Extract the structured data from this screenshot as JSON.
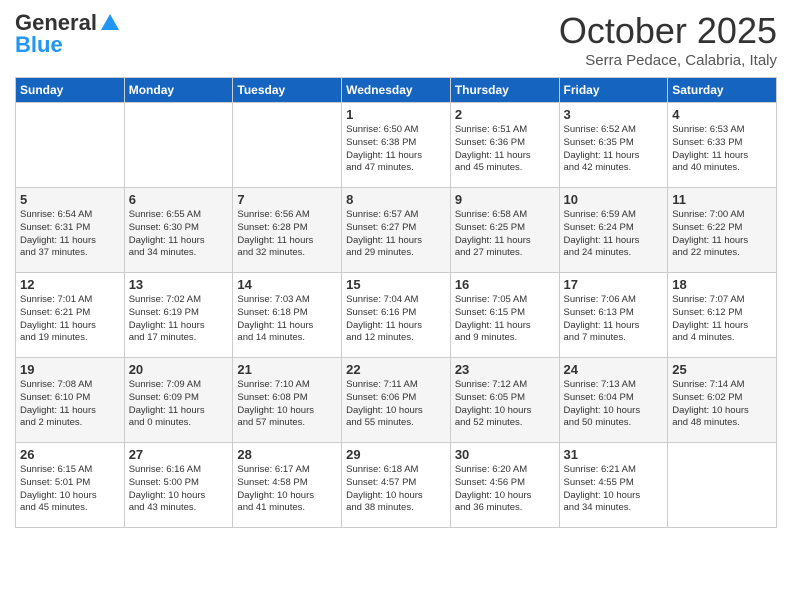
{
  "header": {
    "logo_general": "General",
    "logo_blue": "Blue",
    "month_title": "October 2025",
    "subtitle": "Serra Pedace, Calabria, Italy"
  },
  "days_of_week": [
    "Sunday",
    "Monday",
    "Tuesday",
    "Wednesday",
    "Thursday",
    "Friday",
    "Saturday"
  ],
  "weeks": [
    [
      {
        "day": "",
        "detail": ""
      },
      {
        "day": "",
        "detail": ""
      },
      {
        "day": "",
        "detail": ""
      },
      {
        "day": "1",
        "detail": "Sunrise: 6:50 AM\nSunset: 6:38 PM\nDaylight: 11 hours\nand 47 minutes."
      },
      {
        "day": "2",
        "detail": "Sunrise: 6:51 AM\nSunset: 6:36 PM\nDaylight: 11 hours\nand 45 minutes."
      },
      {
        "day": "3",
        "detail": "Sunrise: 6:52 AM\nSunset: 6:35 PM\nDaylight: 11 hours\nand 42 minutes."
      },
      {
        "day": "4",
        "detail": "Sunrise: 6:53 AM\nSunset: 6:33 PM\nDaylight: 11 hours\nand 40 minutes."
      }
    ],
    [
      {
        "day": "5",
        "detail": "Sunrise: 6:54 AM\nSunset: 6:31 PM\nDaylight: 11 hours\nand 37 minutes."
      },
      {
        "day": "6",
        "detail": "Sunrise: 6:55 AM\nSunset: 6:30 PM\nDaylight: 11 hours\nand 34 minutes."
      },
      {
        "day": "7",
        "detail": "Sunrise: 6:56 AM\nSunset: 6:28 PM\nDaylight: 11 hours\nand 32 minutes."
      },
      {
        "day": "8",
        "detail": "Sunrise: 6:57 AM\nSunset: 6:27 PM\nDaylight: 11 hours\nand 29 minutes."
      },
      {
        "day": "9",
        "detail": "Sunrise: 6:58 AM\nSunset: 6:25 PM\nDaylight: 11 hours\nand 27 minutes."
      },
      {
        "day": "10",
        "detail": "Sunrise: 6:59 AM\nSunset: 6:24 PM\nDaylight: 11 hours\nand 24 minutes."
      },
      {
        "day": "11",
        "detail": "Sunrise: 7:00 AM\nSunset: 6:22 PM\nDaylight: 11 hours\nand 22 minutes."
      }
    ],
    [
      {
        "day": "12",
        "detail": "Sunrise: 7:01 AM\nSunset: 6:21 PM\nDaylight: 11 hours\nand 19 minutes."
      },
      {
        "day": "13",
        "detail": "Sunrise: 7:02 AM\nSunset: 6:19 PM\nDaylight: 11 hours\nand 17 minutes."
      },
      {
        "day": "14",
        "detail": "Sunrise: 7:03 AM\nSunset: 6:18 PM\nDaylight: 11 hours\nand 14 minutes."
      },
      {
        "day": "15",
        "detail": "Sunrise: 7:04 AM\nSunset: 6:16 PM\nDaylight: 11 hours\nand 12 minutes."
      },
      {
        "day": "16",
        "detail": "Sunrise: 7:05 AM\nSunset: 6:15 PM\nDaylight: 11 hours\nand 9 minutes."
      },
      {
        "day": "17",
        "detail": "Sunrise: 7:06 AM\nSunset: 6:13 PM\nDaylight: 11 hours\nand 7 minutes."
      },
      {
        "day": "18",
        "detail": "Sunrise: 7:07 AM\nSunset: 6:12 PM\nDaylight: 11 hours\nand 4 minutes."
      }
    ],
    [
      {
        "day": "19",
        "detail": "Sunrise: 7:08 AM\nSunset: 6:10 PM\nDaylight: 11 hours\nand 2 minutes."
      },
      {
        "day": "20",
        "detail": "Sunrise: 7:09 AM\nSunset: 6:09 PM\nDaylight: 11 hours\nand 0 minutes."
      },
      {
        "day": "21",
        "detail": "Sunrise: 7:10 AM\nSunset: 6:08 PM\nDaylight: 10 hours\nand 57 minutes."
      },
      {
        "day": "22",
        "detail": "Sunrise: 7:11 AM\nSunset: 6:06 PM\nDaylight: 10 hours\nand 55 minutes."
      },
      {
        "day": "23",
        "detail": "Sunrise: 7:12 AM\nSunset: 6:05 PM\nDaylight: 10 hours\nand 52 minutes."
      },
      {
        "day": "24",
        "detail": "Sunrise: 7:13 AM\nSunset: 6:04 PM\nDaylight: 10 hours\nand 50 minutes."
      },
      {
        "day": "25",
        "detail": "Sunrise: 7:14 AM\nSunset: 6:02 PM\nDaylight: 10 hours\nand 48 minutes."
      }
    ],
    [
      {
        "day": "26",
        "detail": "Sunrise: 6:15 AM\nSunset: 5:01 PM\nDaylight: 10 hours\nand 45 minutes."
      },
      {
        "day": "27",
        "detail": "Sunrise: 6:16 AM\nSunset: 5:00 PM\nDaylight: 10 hours\nand 43 minutes."
      },
      {
        "day": "28",
        "detail": "Sunrise: 6:17 AM\nSunset: 4:58 PM\nDaylight: 10 hours\nand 41 minutes."
      },
      {
        "day": "29",
        "detail": "Sunrise: 6:18 AM\nSunset: 4:57 PM\nDaylight: 10 hours\nand 38 minutes."
      },
      {
        "day": "30",
        "detail": "Sunrise: 6:20 AM\nSunset: 4:56 PM\nDaylight: 10 hours\nand 36 minutes."
      },
      {
        "day": "31",
        "detail": "Sunrise: 6:21 AM\nSunset: 4:55 PM\nDaylight: 10 hours\nand 34 minutes."
      },
      {
        "day": "",
        "detail": ""
      }
    ]
  ]
}
